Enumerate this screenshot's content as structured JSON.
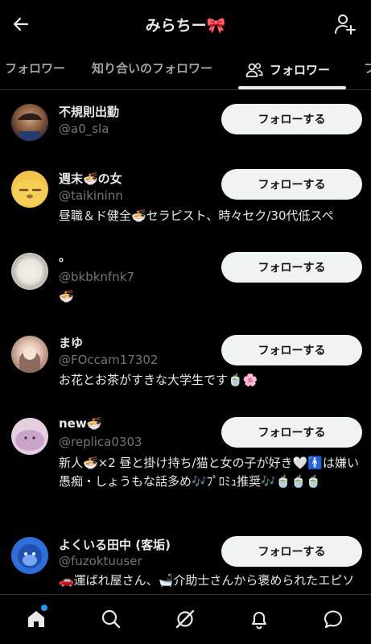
{
  "header": {
    "title": "みらちー🎀",
    "back_icon": "arrow-left-icon",
    "add_user_icon": "add-user-icon"
  },
  "tabs": [
    {
      "label": "フォロワー"
    },
    {
      "label": "知り合いのフォロワー"
    },
    {
      "label": "フォロワー",
      "icon": "people-icon",
      "active": true
    },
    {
      "label": "フ"
    }
  ],
  "users": [
    {
      "name": "不規則出勤",
      "handle": "@a0_sla",
      "bio": "",
      "button": "フォローする"
    },
    {
      "name": "週末🍜の女",
      "handle": "@taikininn",
      "bio": "昼職＆ド健全🍜セラピスト、時々セク/30代低スペ",
      "button": "フォローする"
    },
    {
      "name": "。",
      "handle": "@bkbknfnk7",
      "bio": "🍜",
      "button": "フォローする"
    },
    {
      "name": "まゆ",
      "handle": "@FOccam17302",
      "bio": "お花とお茶がすきな大学生です🍵🌸",
      "button": "フォローする"
    },
    {
      "name": "new🍜",
      "handle": "@replica0303",
      "bio": "新人🍜×2 昼と掛け持ち/猫と女の子が好き🤍🚹は嫌い愚痴・しょうもな話多め🎶ﾌﾟﾛﾐｭ推奨🎶🍵🍵🍵",
      "button": "フォローする"
    },
    {
      "name": "よくいる田中 (客垢)",
      "handle": "@fuzoktuuser",
      "bio": "🚗運ばれ屋さん、🛁介助士さんから褒められたエピソード",
      "button": "フォローする"
    }
  ],
  "bottom_nav": [
    {
      "icon": "home-icon"
    },
    {
      "icon": "search-icon"
    },
    {
      "icon": "grok-icon"
    },
    {
      "icon": "bell-icon"
    },
    {
      "icon": "messages-icon"
    }
  ],
  "colors": {
    "background": "#000000",
    "text": "#e7e9ea",
    "muted": "#71767b",
    "button_bg": "#eff3f4",
    "accent": "#1d9bf0"
  }
}
